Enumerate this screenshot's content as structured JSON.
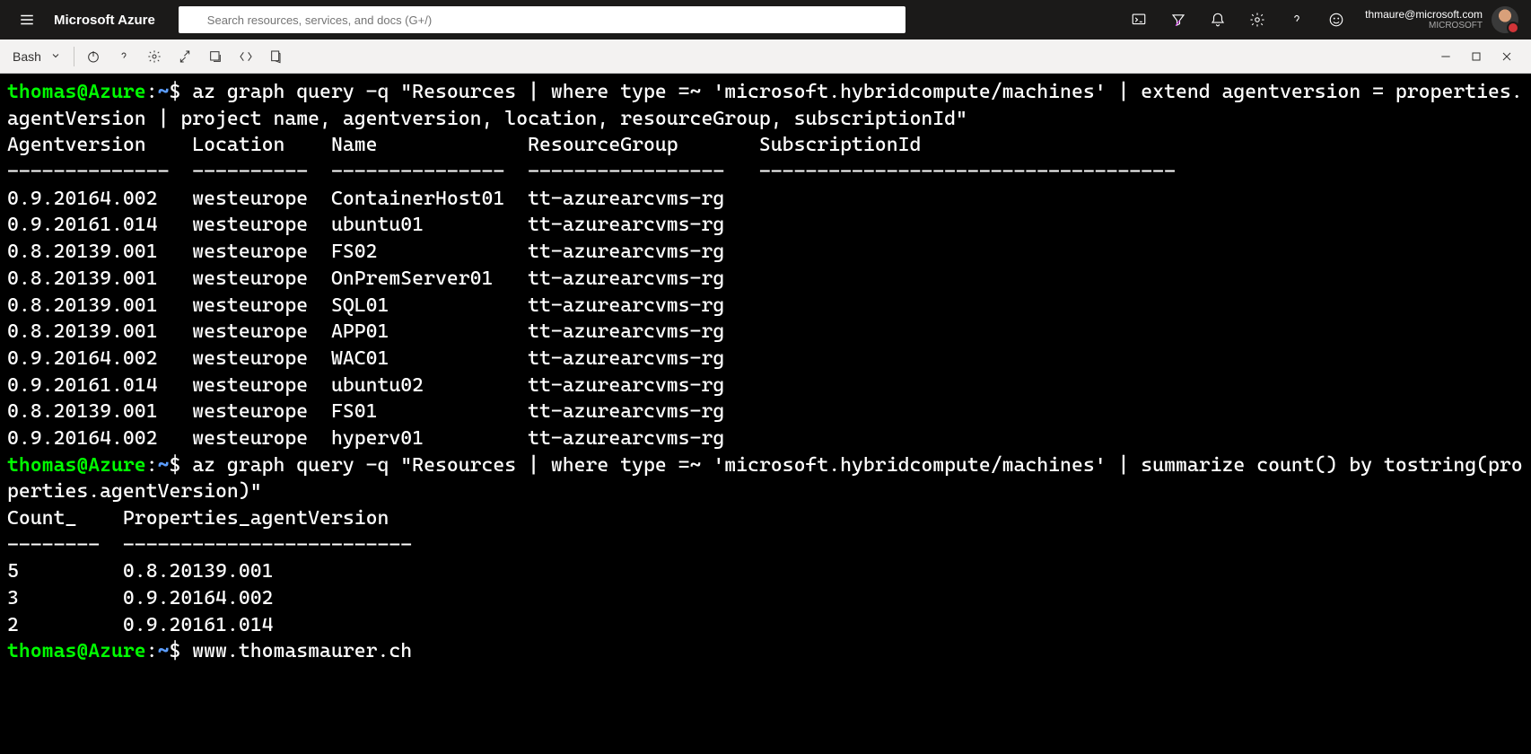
{
  "header": {
    "brand": "Microsoft Azure",
    "search_placeholder": "Search resources, services, and docs (G+/)",
    "user_email": "thmaure@microsoft.com",
    "user_tenant": "MICROSOFT"
  },
  "cloudshell": {
    "shell": "Bash"
  },
  "terminal": {
    "prompt_user": "thomas@Azure",
    "prompt_path": "~",
    "prompt_dollar": "$",
    "cmd1": "az graph query -q \"Resources | where type =~ 'microsoft.hybridcompute/machines' | extend agentversion = properties.agentVersion | project name, agentversion, location, resourceGroup, subscriptionId\"",
    "table1": {
      "headers": [
        "Agentversion",
        "Location",
        "Name",
        "ResourceGroup",
        "SubscriptionId"
      ],
      "dash": [
        "--------------",
        "----------",
        "---------------",
        "-----------------",
        "------------------------------------"
      ],
      "rows": [
        [
          "0.9.20164.002",
          "westeurope",
          "ContainerHost01",
          "tt-azurearcvms-rg",
          ""
        ],
        [
          "0.9.20161.014",
          "westeurope",
          "ubuntu01",
          "tt-azurearcvms-rg",
          ""
        ],
        [
          "0.8.20139.001",
          "westeurope",
          "FS02",
          "tt-azurearcvms-rg",
          ""
        ],
        [
          "0.8.20139.001",
          "westeurope",
          "OnPremServer01",
          "tt-azurearcvms-rg",
          ""
        ],
        [
          "0.8.20139.001",
          "westeurope",
          "SQL01",
          "tt-azurearcvms-rg",
          ""
        ],
        [
          "0.8.20139.001",
          "westeurope",
          "APP01",
          "tt-azurearcvms-rg",
          ""
        ],
        [
          "0.9.20164.002",
          "westeurope",
          "WAC01",
          "tt-azurearcvms-rg",
          ""
        ],
        [
          "0.9.20161.014",
          "westeurope",
          "ubuntu02",
          "tt-azurearcvms-rg",
          ""
        ],
        [
          "0.8.20139.001",
          "westeurope",
          "FS01",
          "tt-azurearcvms-rg",
          ""
        ],
        [
          "0.9.20164.002",
          "westeurope",
          "hyperv01",
          "tt-azurearcvms-rg",
          ""
        ]
      ]
    },
    "cmd2": "az graph query -q \"Resources | where type =~ 'microsoft.hybridcompute/machines' | summarize count() by tostring(properties.agentVersion)\"",
    "table2": {
      "headers": [
        "Count_",
        "Properties_agentVersion"
      ],
      "dash": [
        "--------",
        "-------------------------"
      ],
      "rows": [
        [
          "5",
          "0.8.20139.001"
        ],
        [
          "3",
          "0.9.20164.002"
        ],
        [
          "2",
          "0.9.20161.014"
        ]
      ]
    },
    "cmd3": "www.thomasmaurer.ch"
  }
}
